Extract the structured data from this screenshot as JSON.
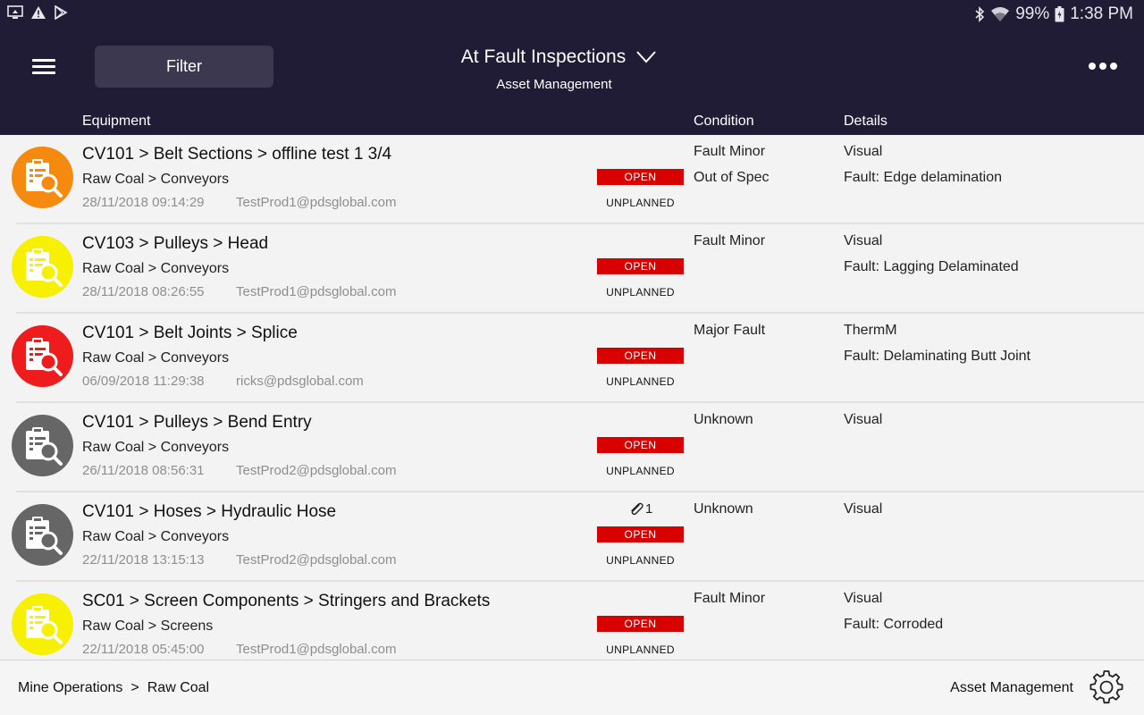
{
  "status_bar": {
    "battery": "99%",
    "time": "1:38 PM",
    "icons": [
      "screen-share-icon",
      "warning-icon",
      "play-store-icon",
      "bluetooth-icon",
      "wifi-icon",
      "battery-icon"
    ]
  },
  "header": {
    "filter_label": "Filter",
    "title": "At Fault Inspections",
    "subtitle": "Asset Management",
    "columns": {
      "equipment": "Equipment",
      "condition": "Condition",
      "details": "Details"
    }
  },
  "rows": [
    {
      "title": "CV101 > Belt Sections > offline test 1 3/4",
      "path": "Raw Coal > Conveyors",
      "date": "28/11/2018 09:14:29",
      "user": "TestProd1@pdsglobal.com",
      "attachments": "",
      "status": "OPEN",
      "type": "UNPLANNED",
      "condition1": "Fault Minor",
      "condition2": "Out of Spec",
      "detail1": "Visual",
      "detail2": "Fault: Edge delamination",
      "color": "#f58a0e"
    },
    {
      "title": "CV103 > Pulleys > Head",
      "path": "Raw Coal > Conveyors",
      "date": "28/11/2018 08:26:55",
      "user": "TestProd1@pdsglobal.com",
      "attachments": "",
      "status": "OPEN",
      "type": "UNPLANNED",
      "condition1": "Fault Minor",
      "condition2": "",
      "detail1": "Visual",
      "detail2": "Fault: Lagging Delaminated",
      "color": "#f7f000"
    },
    {
      "title": "CV101 > Belt Joints > Splice",
      "path": "Raw Coal > Conveyors",
      "date": "06/09/2018 11:29:38",
      "user": "ricks@pdsglobal.com",
      "attachments": "",
      "status": "OPEN",
      "type": "UNPLANNED",
      "condition1": "Major Fault",
      "condition2": "",
      "detail1": "ThermM",
      "detail2": "Fault: Delaminating Butt Joint",
      "color": "#ee1c1c"
    },
    {
      "title": "CV101 > Pulleys > Bend Entry",
      "path": "Raw Coal > Conveyors",
      "date": "26/11/2018 08:56:31",
      "user": "TestProd2@pdsglobal.com",
      "attachments": "",
      "status": "OPEN",
      "type": "UNPLANNED",
      "condition1": "Unknown",
      "condition2": "",
      "detail1": "Visual",
      "detail2": "",
      "color": "#666666"
    },
    {
      "title": "CV101 > Hoses > Hydraulic Hose",
      "path": "Raw Coal > Conveyors",
      "date": "22/11/2018 13:15:13",
      "user": "TestProd2@pdsglobal.com",
      "attachments": "1",
      "status": "OPEN",
      "type": "UNPLANNED",
      "condition1": "Unknown",
      "condition2": "",
      "detail1": "Visual",
      "detail2": "",
      "color": "#666666"
    },
    {
      "title": "SC01 > Screen Components > Stringers and Brackets",
      "path": "Raw Coal > Screens",
      "date": "22/11/2018 05:45:00",
      "user": "TestProd1@pdsglobal.com",
      "attachments": "",
      "status": "OPEN",
      "type": "UNPLANNED",
      "condition1": "Fault Minor",
      "condition2": "",
      "detail1": "Visual",
      "detail2": "Fault: Corroded",
      "color": "#f7f000"
    }
  ],
  "footer": {
    "crumb1": "Mine Operations",
    "separator": ">",
    "crumb2": "Raw Coal",
    "module": "Asset Management"
  },
  "colors": {
    "header_bg": "#201c36",
    "status_open": "#d90000"
  }
}
